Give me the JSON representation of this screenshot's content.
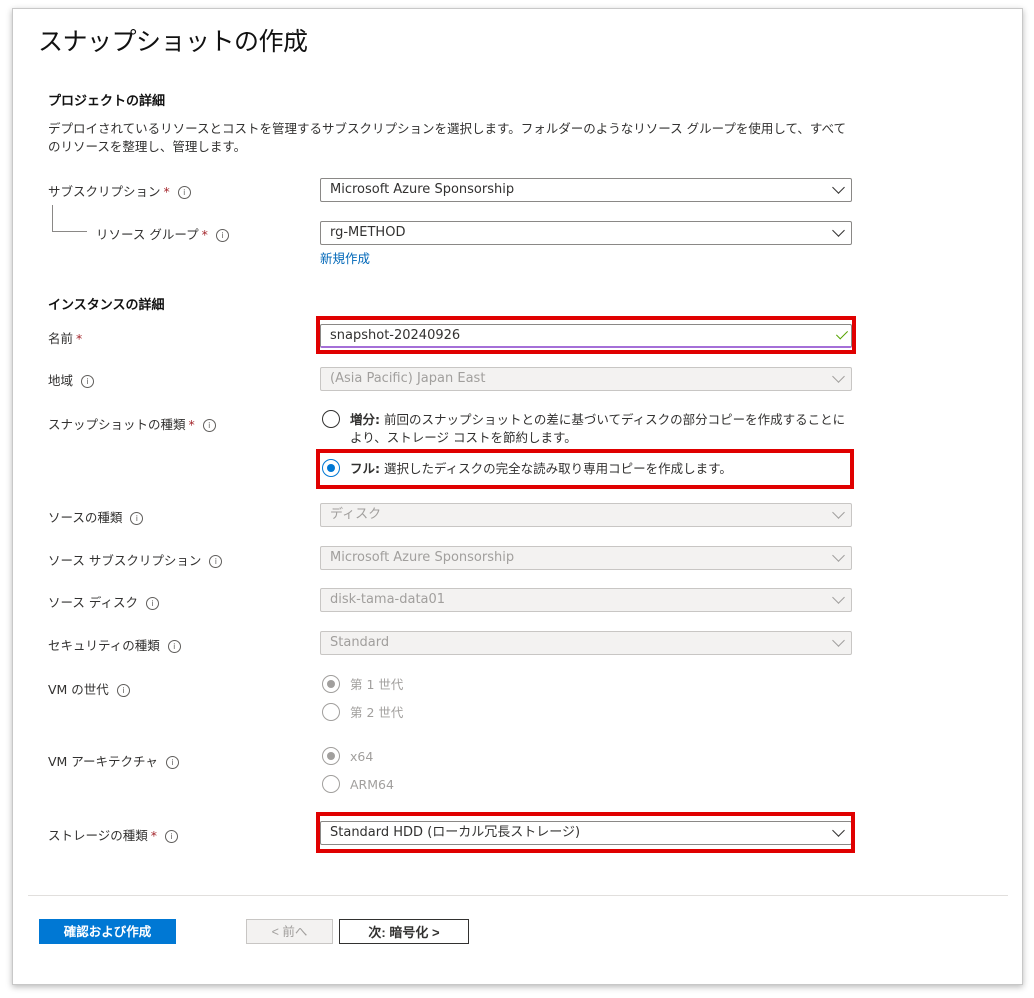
{
  "header": {
    "title": "スナップショットの作成",
    "more": "···"
  },
  "project": {
    "title": "プロジェクトの詳細",
    "description": "デプロイされているリソースとコストを管理するサブスクリプションを選択します。フォルダーのようなリソース グループを使用して、すべてのリソースを整理し、管理します。",
    "subscription_label": "サブスクリプション",
    "subscription_value": "Microsoft Azure Sponsorship",
    "resource_group_label": "リソース グループ",
    "resource_group_value": "rg-METHOD",
    "create_new": "新規作成"
  },
  "instance": {
    "title": "インスタンスの詳細",
    "name_label": "名前",
    "name_value": "snapshot-20240926",
    "region_label": "地域",
    "region_value": "(Asia Pacific) Japan East",
    "snapshot_type_label": "スナップショットの種類",
    "incremental_title": "増分:",
    "incremental_desc": "前回のスナップショットとの差に基づいてディスクの部分コピーを作成することにより、ストレージ コストを節約します。",
    "full_title": "フル:",
    "full_desc": "選択したディスクの完全な読み取り専用コピーを作成します。",
    "source_type_label": "ソースの種類",
    "source_type_value": "ディスク",
    "source_sub_label": "ソース サブスクリプション",
    "source_sub_value": "Microsoft Azure Sponsorship",
    "source_disk_label": "ソース ディスク",
    "source_disk_value": "disk-tama-data01",
    "security_label": "セキュリティの種類",
    "security_value": "Standard",
    "vm_gen_label": "VM の世代",
    "vm_gen_options": [
      "第 1 世代",
      "第 2 世代"
    ],
    "vm_arch_label": "VM アーキテクチャ",
    "vm_arch_options": [
      "x64",
      "ARM64"
    ],
    "storage_label": "ストレージの種類",
    "storage_value": "Standard HDD (ローカル冗長ストレージ)"
  },
  "footer": {
    "review_create": "確認および作成",
    "prev": "< 前へ",
    "next": "次: 暗号化 >"
  },
  "common": {
    "required": "*",
    "info": "i"
  },
  "colors": {
    "accent": "#0078d4",
    "highlight": "#e00000",
    "required": "#a4262c"
  }
}
